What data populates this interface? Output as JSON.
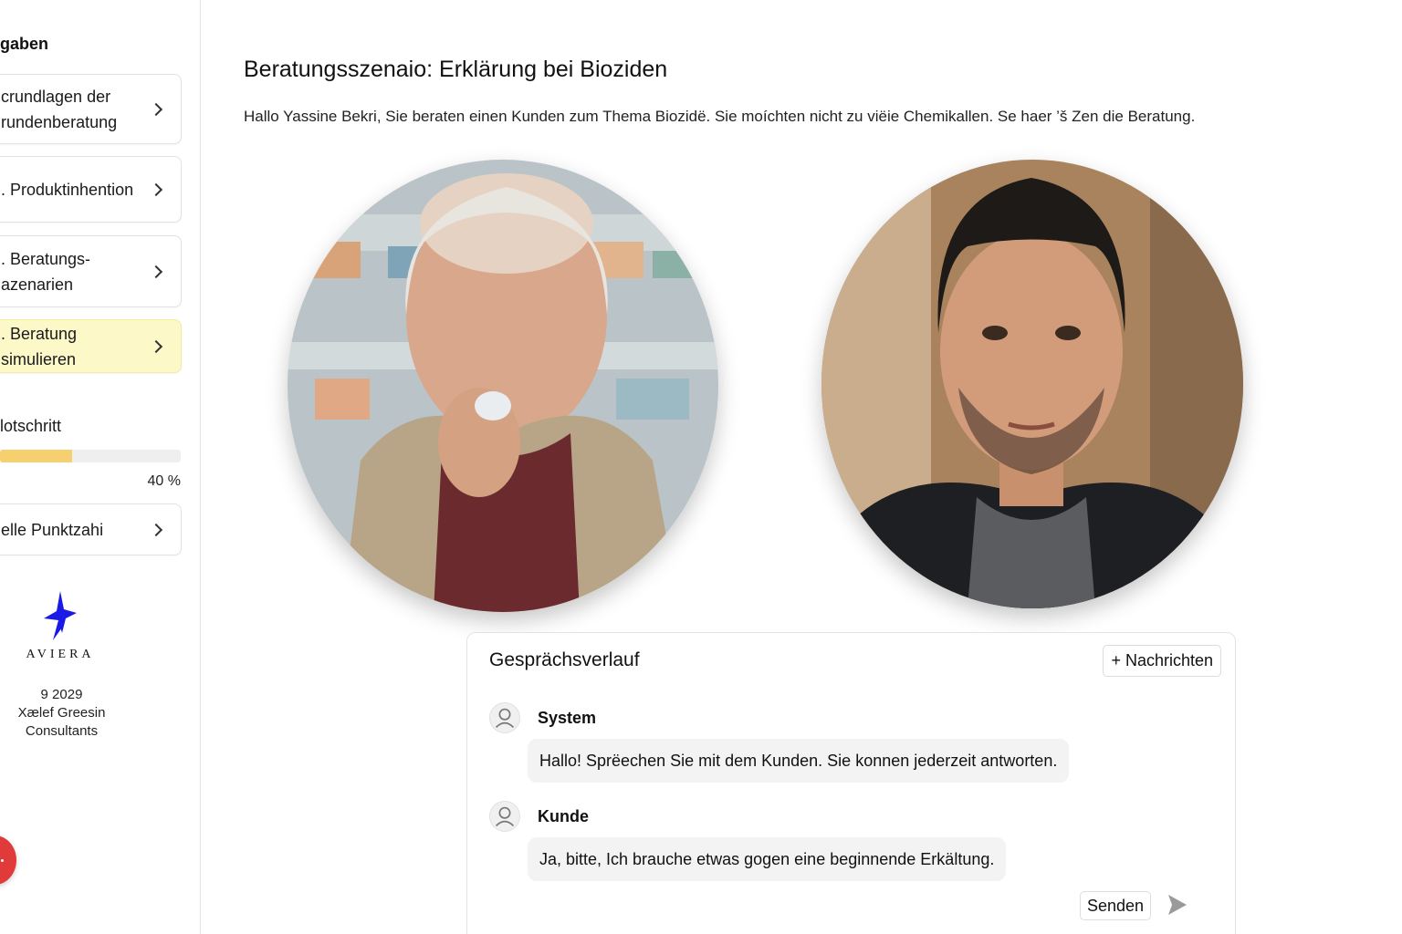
{
  "sidebar": {
    "heading": "gaben",
    "items": [
      {
        "label": "crundlagen der\nrundenberatung",
        "active": false
      },
      {
        "label": ". Produktinhention",
        "active": false
      },
      {
        "label": ". Beratungs-\nazenarien",
        "active": false
      },
      {
        "label": ". Beratung simulieren",
        "active": true
      }
    ],
    "progress": {
      "label": "lotschritt",
      "percent_text": "40 %",
      "value": 0.4,
      "fill_color": "#f6d06f"
    },
    "score_item": {
      "label": "elle Punktzahi"
    },
    "logo": {
      "text": "AVIERA",
      "color": "#1a1ae6"
    },
    "footer": "9 2029\nXælef Greesin\nConsultants"
  },
  "main": {
    "title": "Beratungsszenaio: Erklärung bei Bioziden",
    "intro": "Hallo Yassine Bekri, Sie beraten einen Kunden zum Thema Biozidë. Sie moíchten nicht zu viëie Chemikallen. Se haer ’š Zen die Beratung."
  },
  "chat": {
    "title": "Gesprächsverlauf",
    "new_message_label": "+ Nachrichten",
    "messages": [
      {
        "sender": "System",
        "text": "Hallo! Sprëechen Sie mit dem Kunden. Sie konnen jederzeit antworten."
      },
      {
        "sender": "Kunde",
        "text": "Ja, bitte, Ich brauche etwas gogen eine beginnende Erkältung."
      }
    ],
    "send_label": "Senden"
  },
  "colors": {
    "accent_active": "#fdf8c8",
    "fab": "#e03a3a",
    "logo": "#1a1ae6"
  }
}
